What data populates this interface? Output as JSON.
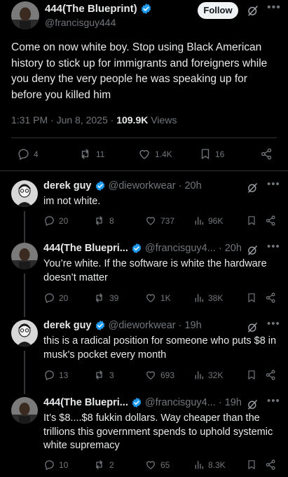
{
  "main_tweet": {
    "author_name": "444(The Blueprint)",
    "handle": "@francisguy444",
    "follow_label": "Follow",
    "body": "Come on now white boy. Stop using Black American history to stick up for immigrants and foreigners while you deny the very people he was speaking up for before you killed him",
    "time": "1:31 PM · Jun 8, 2025 · ",
    "views_count": "109.9K",
    "views_label": " Views",
    "replies": "4",
    "reposts": "11",
    "likes": "1.4K",
    "bookmarks": "16"
  },
  "replies": [
    {
      "author_name": "derek guy",
      "handle": "@dieworkwear",
      "time": "· 20h",
      "text": "im not white.",
      "replies": "20",
      "reposts": "8",
      "likes": "737",
      "views": "96K"
    },
    {
      "author_name": "444(The Bluepri...",
      "handle": "@francisguy4...",
      "time": "· 20h",
      "text": "You’re white. If the software is white the hardware doesn’t matter",
      "replies": "20",
      "reposts": "39",
      "likes": "1K",
      "views": "38K"
    },
    {
      "author_name": "derek guy",
      "handle": "@dieworkwear",
      "time": "· 19h",
      "text": "this is a radical position for someone who puts $8 in musk's pocket every month",
      "replies": "13",
      "reposts": "3",
      "likes": "693",
      "views": "32K"
    },
    {
      "author_name": "444(The Bluepri...",
      "handle": "@francisguy4...",
      "time": "· 19h",
      "text": "It’s $8....$8 fukkin dollars. Way cheaper than the trillions this government spends to uphold systemic white supremacy",
      "replies": "10",
      "reposts": "2",
      "likes": "65",
      "views": "8.3K"
    }
  ],
  "colors": {
    "background": "#000000",
    "text": "#e7e9ea",
    "muted": "#71767b",
    "verified": "#1d9bf0",
    "divider": "#2f3336"
  },
  "icons": [
    "verified-badge-icon",
    "grok-icon",
    "more-icon",
    "reply-icon",
    "repost-icon",
    "like-icon",
    "views-icon",
    "bookmark-icon",
    "share-icon"
  ]
}
